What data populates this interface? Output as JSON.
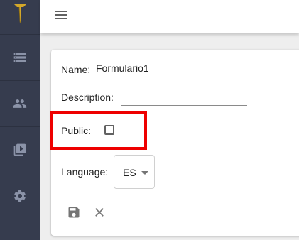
{
  "sidebar": {
    "logo_icon": "gold-sword-logo-icon",
    "items": [
      {
        "icon": "storage-icon"
      },
      {
        "icon": "people-icon"
      },
      {
        "icon": "video-library-icon"
      },
      {
        "icon": "gear-icon"
      }
    ]
  },
  "topbar": {
    "menu_icon": "hamburger-menu-icon"
  },
  "form": {
    "name_label": "Name:",
    "name_value": "Formulario1",
    "description_label": "Description:",
    "description_value": "",
    "public_label": "Public:",
    "public_checked": false,
    "language_label": "Language:",
    "language_value": "ES"
  },
  "actions": {
    "save_icon": "save-icon",
    "close_icon": "close-icon"
  },
  "colors": {
    "sidebar": "#363c4e",
    "highlight": "#ee0000",
    "icon": "#757575",
    "logo": "#d4a82a"
  }
}
